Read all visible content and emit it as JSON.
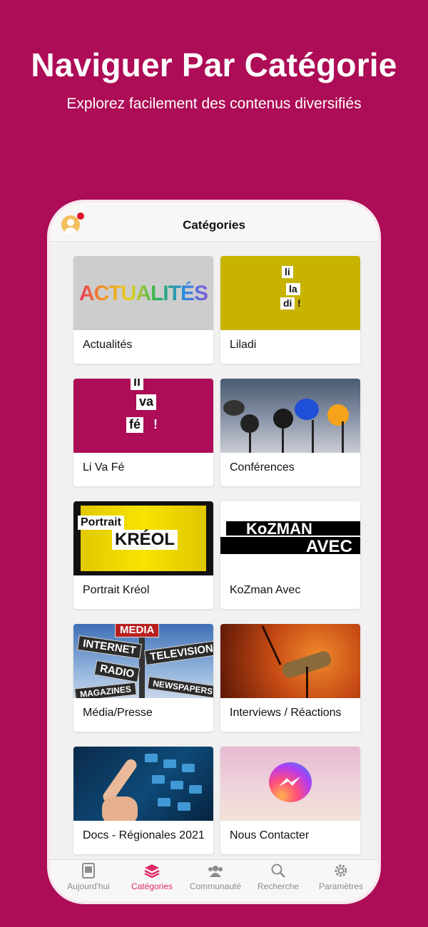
{
  "promo": {
    "headline": "Naviguer Par Catégorie",
    "subline": "Explorez facilement des contenus diversifiés"
  },
  "nav": {
    "title": "Catégories"
  },
  "categories": [
    {
      "label": "Actualités",
      "thumb_text": "ACTUALITÉS"
    },
    {
      "label": "Liladi",
      "thumb_text": [
        "li",
        "la",
        "di",
        "!"
      ]
    },
    {
      "label": "Li Va Fé",
      "thumb_text": [
        "li",
        "va",
        "fé",
        "!"
      ]
    },
    {
      "label": "Conférences"
    },
    {
      "label": "Portrait Kréol",
      "thumb_text": [
        "Portrait",
        "KRÉOL"
      ]
    },
    {
      "label": "KoZman Avec",
      "thumb_text": [
        "KoZMAN",
        "AVEC"
      ]
    },
    {
      "label": "Média/Presse",
      "thumb_text": [
        "MEDIA",
        "INTERNET",
        "TELEVISION",
        "RADIO",
        "NEWSPAPERS",
        "MAGAZINES"
      ]
    },
    {
      "label": "Interviews / Réactions"
    },
    {
      "label": "Docs - Régionales 2021"
    },
    {
      "label": "Nous Contacter"
    }
  ],
  "tabs": [
    {
      "label": "Aujourd'hui",
      "icon": "newspaper-icon",
      "active": false
    },
    {
      "label": "Catégories",
      "icon": "layers-icon",
      "active": true
    },
    {
      "label": "Communauté",
      "icon": "people-icon",
      "active": false
    },
    {
      "label": "Recherche",
      "icon": "search-icon",
      "active": false
    },
    {
      "label": "Paramètres",
      "icon": "gear-icon",
      "active": false
    }
  ],
  "colors": {
    "brand": "#ad0c56",
    "active_tab": "#e02a63",
    "inactive_tab": "#8c8c8c"
  }
}
